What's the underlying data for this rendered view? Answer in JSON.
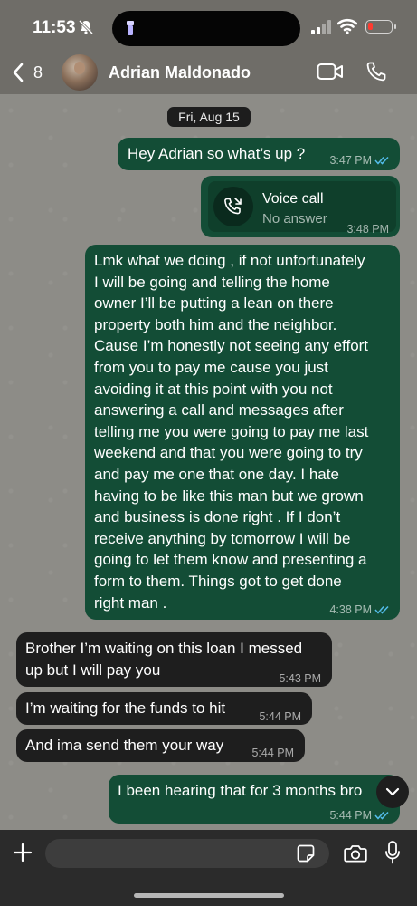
{
  "status_bar": {
    "time": "11:53"
  },
  "header": {
    "back_count": "8",
    "contact_name": "Adrian Maldonado"
  },
  "chat": {
    "date": "Fri, Aug 15",
    "messages": [
      {
        "direction": "outgoing",
        "text": "Hey Adrian so what’s up ?",
        "time": "3:47 PM",
        "read": true
      },
      {
        "direction": "outgoing",
        "type": "voice-call",
        "title": "Voice call",
        "subtitle": "No answer",
        "time": "3:48 PM"
      },
      {
        "direction": "outgoing",
        "lines": [
          "Lmk what we doing , if not unfortunately",
          "I will be going and telling the home",
          "owner I’ll be putting a lean on there",
          "property both him and the neighbor.",
          "Cause I’m honestly not seeing any effort",
          "from you to pay me cause you just",
          "avoiding it at this point with you not",
          "answering a call and messages after",
          "telling me you were going to pay me last",
          "weekend and that you were going to try",
          "and pay me one that one day. I hate",
          "having to be like this man but we grown",
          "and business is done right . If I don’t",
          "receive anything by tomorrow I will be",
          "going to let them know and presenting a",
          "form to them. Things got to get done",
          "right man ."
        ],
        "time": "4:38 PM",
        "read": true
      },
      {
        "direction": "incoming",
        "lines": [
          "Brother I’m waiting on this loan I messed",
          "up but I will pay you"
        ],
        "time": "5:43 PM"
      },
      {
        "direction": "incoming",
        "text": "I’m waiting for the funds to hit",
        "time": "5:44 PM"
      },
      {
        "direction": "incoming",
        "text": "And ima send them your way",
        "time": "5:44 PM"
      },
      {
        "direction": "outgoing",
        "text": "I been hearing that for 3 months bro",
        "time": "5:44 PM",
        "read": true
      }
    ]
  },
  "input": {
    "placeholder": ""
  },
  "icons": [
    "bell-slash-icon",
    "flashlight-icon",
    "signal-icon",
    "wifi-icon",
    "battery-icon",
    "back-chevron-icon",
    "video-icon",
    "phone-icon",
    "missed-call-icon",
    "double-check-icon",
    "chevron-down-icon",
    "plus-icon",
    "sticker-icon",
    "camera-icon",
    "mic-icon"
  ],
  "colors": {
    "outgoing_bubble": "#134d36",
    "incoming_bubble": "#1e1e1e",
    "read_ticks": "#53bdeb",
    "battery_low": "#ff3b30"
  }
}
